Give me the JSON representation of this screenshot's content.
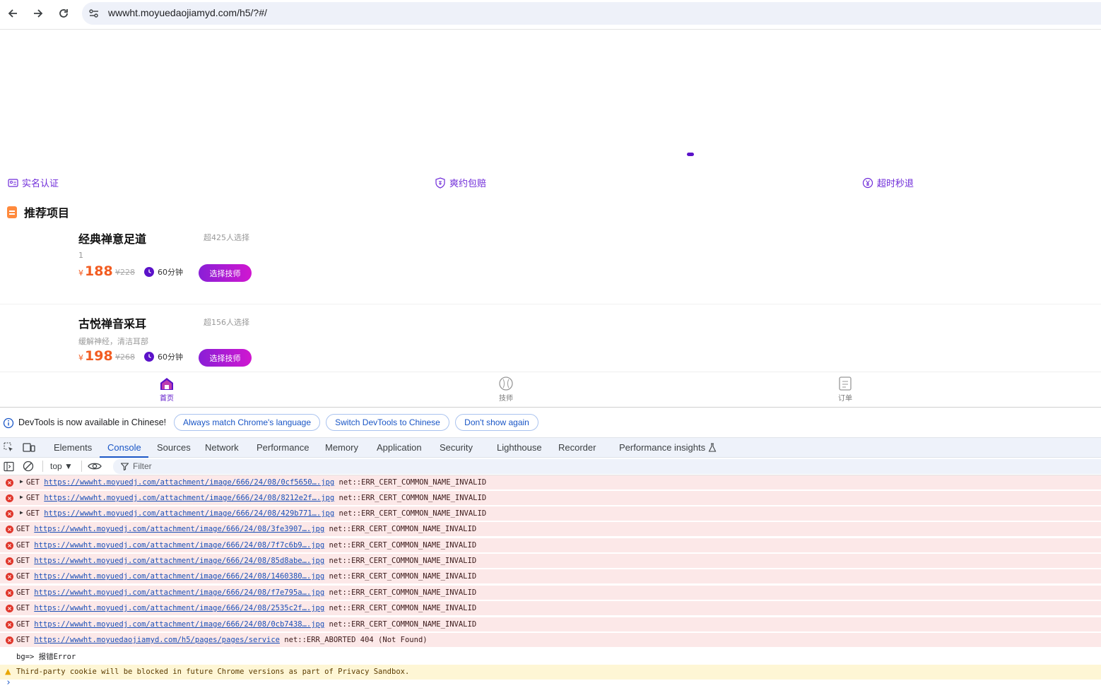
{
  "browser": {
    "url": "wwwht.moyuedaojiamyd.com/h5/?#/"
  },
  "page": {
    "features": [
      {
        "label": "实名认证",
        "icon": "id-card-icon"
      },
      {
        "label": "爽约包赔",
        "icon": "shield-icon"
      },
      {
        "label": "超时秒退",
        "icon": "yen-circle-icon"
      }
    ],
    "section_title": "推荐项目",
    "items": [
      {
        "name": "经典禅意足道",
        "popularity": "超425人选择",
        "desc": "1",
        "currency": "¥",
        "price": "188",
        "original_price": "¥228",
        "duration": "60分钟",
        "button": "选择技师"
      },
      {
        "name": "古悦禅音采耳",
        "popularity": "超156人选择",
        "desc": "缓解神经，清洁耳部",
        "currency": "¥",
        "price": "198",
        "original_price": "¥268",
        "duration": "60分钟",
        "button": "选择技师"
      }
    ],
    "tabbar": [
      {
        "label": "首页",
        "active": true
      },
      {
        "label": "技师",
        "active": false
      },
      {
        "label": "订单",
        "active": false
      }
    ],
    "accent_color": "#5b12c9"
  },
  "devtools": {
    "infobar": {
      "message": "DevTools is now available in Chinese!",
      "btn_match": "Always match Chrome's language",
      "btn_switch": "Switch DevTools to Chinese",
      "btn_dismiss": "Don't show again"
    },
    "tabs": [
      "Elements",
      "Console",
      "Sources",
      "Network",
      "Performance",
      "Memory",
      "Application",
      "Security",
      "Lighthouse",
      "Recorder",
      "Performance insights"
    ],
    "active_tab": "Console",
    "context": "top",
    "filter_placeholder": "Filter",
    "console_rows": [
      {
        "type": "error",
        "expandable": true,
        "method": "GET",
        "url": "https://wwwht.moyuedj.com/attachment/image/666/24/08/0cf5650….jpg",
        "status": "net::ERR_CERT_COMMON_NAME_INVALID"
      },
      {
        "type": "error",
        "expandable": true,
        "method": "GET",
        "url": "https://wwwht.moyuedj.com/attachment/image/666/24/08/8212e2f….jpg",
        "status": "net::ERR_CERT_COMMON_NAME_INVALID"
      },
      {
        "type": "error",
        "expandable": true,
        "method": "GET",
        "url": "https://wwwht.moyuedj.com/attachment/image/666/24/08/429b771….jpg",
        "status": "net::ERR_CERT_COMMON_NAME_INVALID"
      },
      {
        "type": "error",
        "expandable": false,
        "method": "GET",
        "url": "https://wwwht.moyuedj.com/attachment/image/666/24/08/3fe3907….jpg",
        "status": "net::ERR_CERT_COMMON_NAME_INVALID"
      },
      {
        "type": "error",
        "expandable": false,
        "method": "GET",
        "url": "https://wwwht.moyuedj.com/attachment/image/666/24/08/7f7c6b9….jpg",
        "status": "net::ERR_CERT_COMMON_NAME_INVALID"
      },
      {
        "type": "error",
        "expandable": false,
        "method": "GET",
        "url": "https://wwwht.moyuedj.com/attachment/image/666/24/08/85d8abe….jpg",
        "status": "net::ERR_CERT_COMMON_NAME_INVALID"
      },
      {
        "type": "error",
        "expandable": false,
        "method": "GET",
        "url": "https://wwwht.moyuedj.com/attachment/image/666/24/08/1460380….jpg",
        "status": "net::ERR_CERT_COMMON_NAME_INVALID"
      },
      {
        "type": "error",
        "expandable": false,
        "method": "GET",
        "url": "https://wwwht.moyuedj.com/attachment/image/666/24/08/f7e795a….jpg",
        "status": "net::ERR_CERT_COMMON_NAME_INVALID"
      },
      {
        "type": "error",
        "expandable": false,
        "method": "GET",
        "url": "https://wwwht.moyuedj.com/attachment/image/666/24/08/2535c2f….jpg",
        "status": "net::ERR_CERT_COMMON_NAME_INVALID"
      },
      {
        "type": "error",
        "expandable": false,
        "method": "GET",
        "url": "https://wwwht.moyuedj.com/attachment/image/666/24/08/0cb7438….jpg",
        "status": "net::ERR_CERT_COMMON_NAME_INVALID"
      },
      {
        "type": "error",
        "expandable": false,
        "method": "GET",
        "url": "https://wwwht.moyuedaojiamyd.com/h5/pages/pages/service",
        "status": "net::ERR_ABORTED 404 (Not Found)"
      },
      {
        "type": "log",
        "text": "bg=> 报错Error"
      },
      {
        "type": "warning",
        "text": "Third-party cookie will be blocked in future Chrome versions as part of Privacy Sandbox."
      }
    ]
  }
}
